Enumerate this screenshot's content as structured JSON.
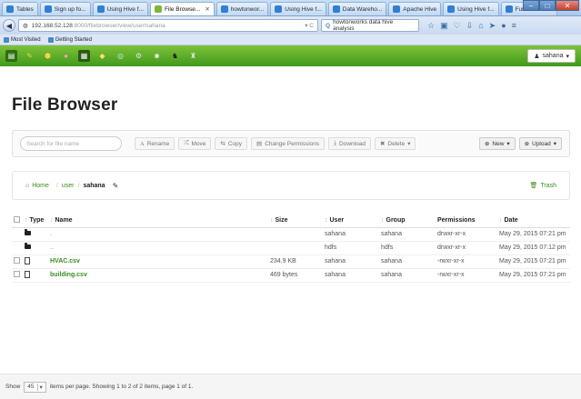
{
  "browser": {
    "tabs": [
      {
        "label": "Tables",
        "active": false
      },
      {
        "label": "Sign up fo...",
        "active": false
      },
      {
        "label": "Using Hive f...",
        "active": false
      },
      {
        "label": "File Browse...",
        "active": true
      },
      {
        "label": "howtonwor...",
        "active": false
      },
      {
        "label": "Using Hive f...",
        "active": false
      },
      {
        "label": "Data Wareho...",
        "active": false
      },
      {
        "label": "Apache Hive",
        "active": false
      },
      {
        "label": "Using Hive f...",
        "active": false
      },
      {
        "label": "Function Tut...",
        "active": false
      }
    ],
    "url_host": "192.168.52.128",
    "url_path": ":8000/filebrowser/view/user/sahana",
    "search_text": "howtonworks data hive analysis",
    "bookmarks": [
      "Most Visited",
      "Getting Started"
    ]
  },
  "hue": {
    "user_menu": "sahana"
  },
  "page": {
    "title": "File Browser"
  },
  "toolbar": {
    "search_placeholder": "Search for file name",
    "rename": "Rename",
    "move": "Move",
    "copy": "Copy",
    "change_permissions": "Change Permissions",
    "download": "Download",
    "delete": "Delete",
    "new": "New",
    "upload": "Upload"
  },
  "breadcrumb": {
    "home": "Home",
    "path_user": "user",
    "path_current": "sahana",
    "trash": "Trash"
  },
  "table": {
    "headers": {
      "type": "Type",
      "name": "Name",
      "size": "Size",
      "user": "User",
      "group": "Group",
      "permissions": "Permissions",
      "date": "Date"
    },
    "rows": [
      {
        "type": "folder",
        "name": ".",
        "size": "",
        "user": "sahana",
        "group": "sahana",
        "permissions": "drwxr-xr-x",
        "date": "May 29, 2015 07:21 pm"
      },
      {
        "type": "folder",
        "name": "..",
        "size": "",
        "user": "hdfs",
        "group": "hdfs",
        "permissions": "drwxr-xr-x",
        "date": "May 29, 2015 07:12 pm"
      },
      {
        "type": "file",
        "name": "HVAC.csv",
        "size": "234.9 KB",
        "user": "sahana",
        "group": "sahana",
        "permissions": "-rwxr-xr-x",
        "date": "May 29, 2015 07:21 pm"
      },
      {
        "type": "file",
        "name": "building.csv",
        "size": "469 bytes",
        "user": "sahana",
        "group": "sahana",
        "permissions": "-rwxr-xr-x",
        "date": "May 29, 2015 07:21 pm"
      }
    ]
  },
  "footer": {
    "show_label": "Show",
    "per_page_value": "45",
    "summary": "items per page. Showing 1 to 2 of 2 items, page 1 of 1."
  },
  "colors": {
    "accent_green": "#3a8d1e",
    "huebar_top": "#7ec23a",
    "huebar_bottom": "#3f9a19"
  }
}
